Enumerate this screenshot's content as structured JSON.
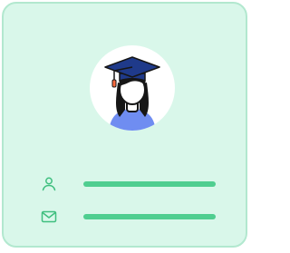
{
  "card": {
    "background": "#d9f7ea",
    "border": "#b2e8cf",
    "line_color": "#4fce90"
  },
  "avatar": {
    "icon": "graduate-avatar-icon",
    "circle_color": "#ffffff",
    "cap_color": "#1f3a8a",
    "shirt_color": "#6f8df1",
    "tassel_color": "#ff6b3d"
  },
  "fields": [
    {
      "icon": "user-icon"
    },
    {
      "icon": "mail-icon"
    }
  ]
}
